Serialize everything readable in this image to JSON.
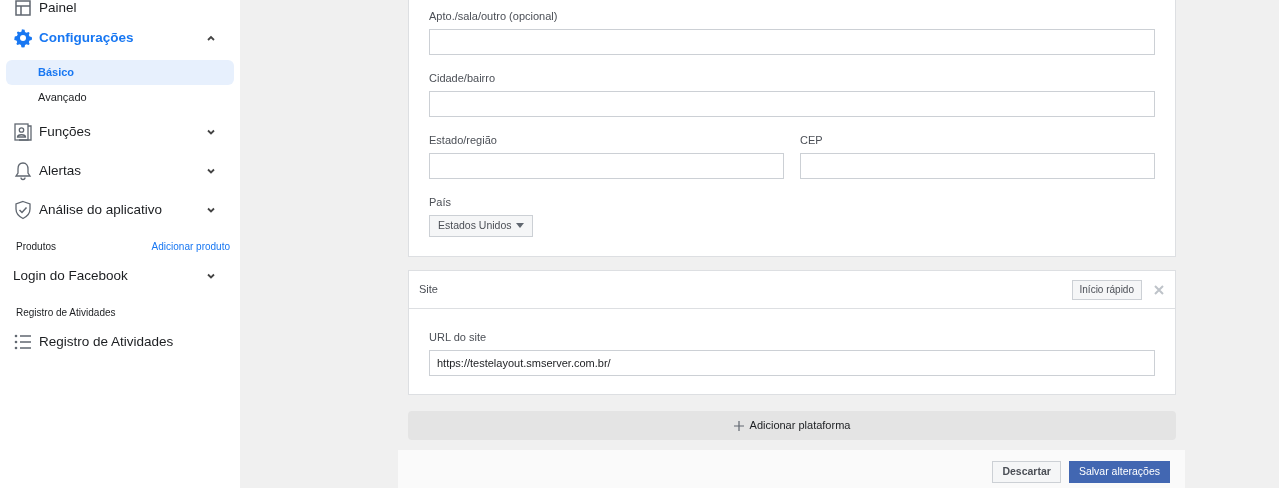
{
  "sidebar": {
    "sections": [
      {
        "items": [
          {
            "label": "Painel"
          },
          {
            "label": "Configurações",
            "expanded": true,
            "children": [
              {
                "label": "Básico",
                "selected": true
              },
              {
                "label": "Avançado",
                "selected": false
              }
            ]
          },
          {
            "label": "Funções",
            "expanded": false
          },
          {
            "label": "Alertas",
            "expanded": false
          },
          {
            "label": "Análise do aplicativo",
            "expanded": false
          }
        ]
      },
      {
        "heading": "Produtos",
        "link": "Adicionar produto",
        "items": [
          {
            "label": "Login do Facebook",
            "expanded": false
          }
        ]
      },
      {
        "heading": "Registro de Atividades",
        "items": [
          {
            "label": "Registro de Atividades"
          }
        ]
      }
    ]
  },
  "address_card": {
    "fields": [
      {
        "kind": "wide",
        "label": "Apto./sala/outro (opcional)"
      },
      {
        "kind": "wide",
        "label": "Cidade/bairro"
      },
      {
        "kind": "half",
        "label": "Estado/região"
      },
      {
        "kind": "half",
        "label": "CEP"
      }
    ],
    "country": {
      "label": "País",
      "value": "Estados Unidos"
    }
  },
  "site_card": {
    "title": "Site",
    "quick_start": "Início rápido",
    "field": {
      "label": "URL do site",
      "value": "https://testelayout.smserver.com.br/"
    }
  },
  "add_platform": "Adicionar plataforma",
  "footer": {
    "buttons": [
      {
        "kind": "secondary",
        "label": "Descartar"
      },
      {
        "kind": "primary",
        "label": "Salvar alterações"
      }
    ]
  }
}
